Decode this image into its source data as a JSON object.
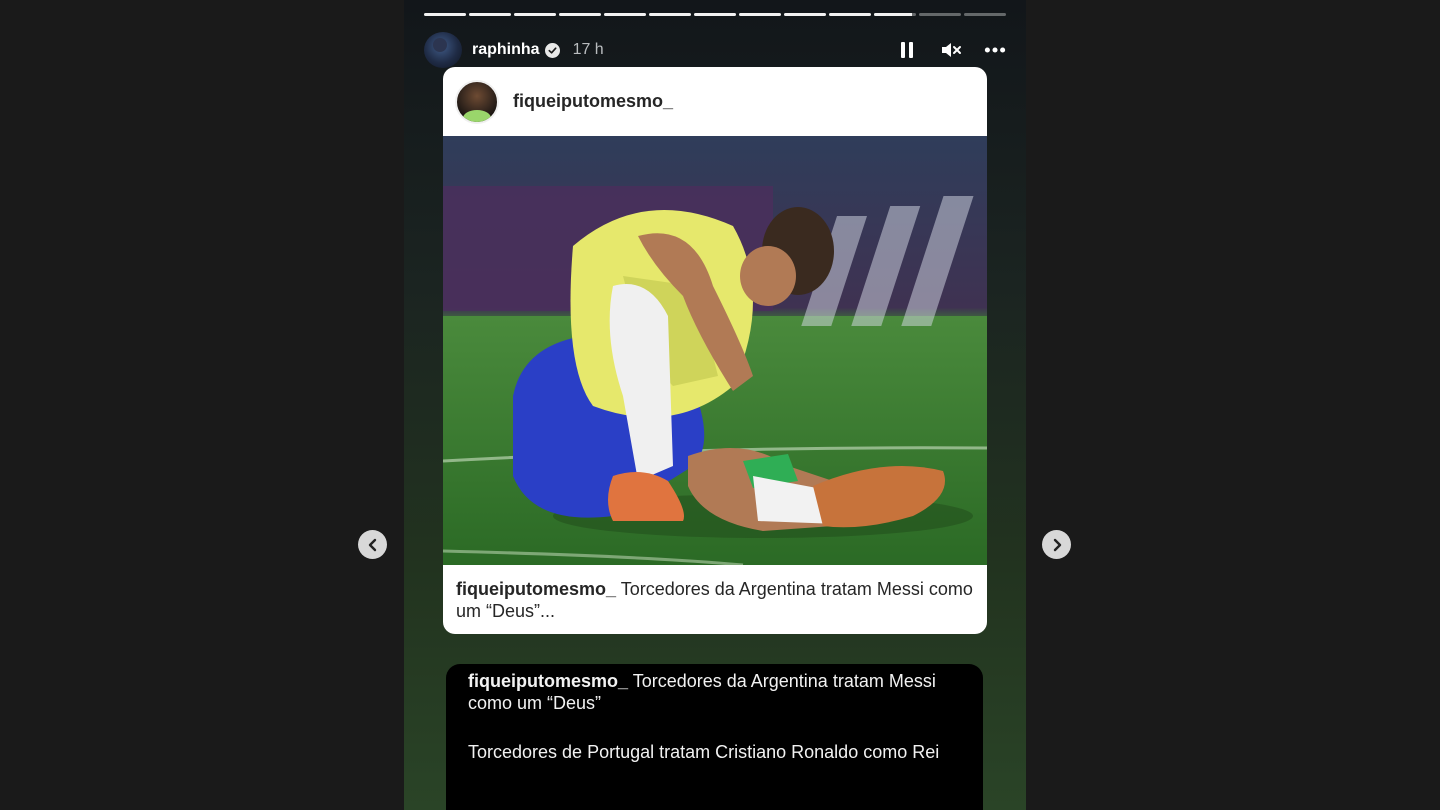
{
  "story": {
    "progress": {
      "segments": 13,
      "completed": 10,
      "current_fill": 0.9
    },
    "header": {
      "username": "raphinha",
      "verified": true,
      "time": "17 h",
      "icons": [
        "pause-icon",
        "mute-icon",
        "more-icon"
      ]
    },
    "shared_post": {
      "username": "fiqueiputomesmo_",
      "caption_user": "fiqueiputomesmo_",
      "caption_text": " Torcedores da Argentina tratam Messi como um “Deus”..."
    },
    "comment": {
      "user": "fiqueiputomesmo_",
      "line1": " Torcedores da Argentina tratam Messi como um “Deus”",
      "line2": "Torcedores de Portugal tratam Cristiano Ronaldo como Rei"
    }
  },
  "navigation": {
    "prev_icon": "chevron-left-icon",
    "next_icon": "chevron-right-icon"
  },
  "colors": {
    "background": "#1a1a1a",
    "card": "#ffffff",
    "comment_bg": "#000000"
  }
}
